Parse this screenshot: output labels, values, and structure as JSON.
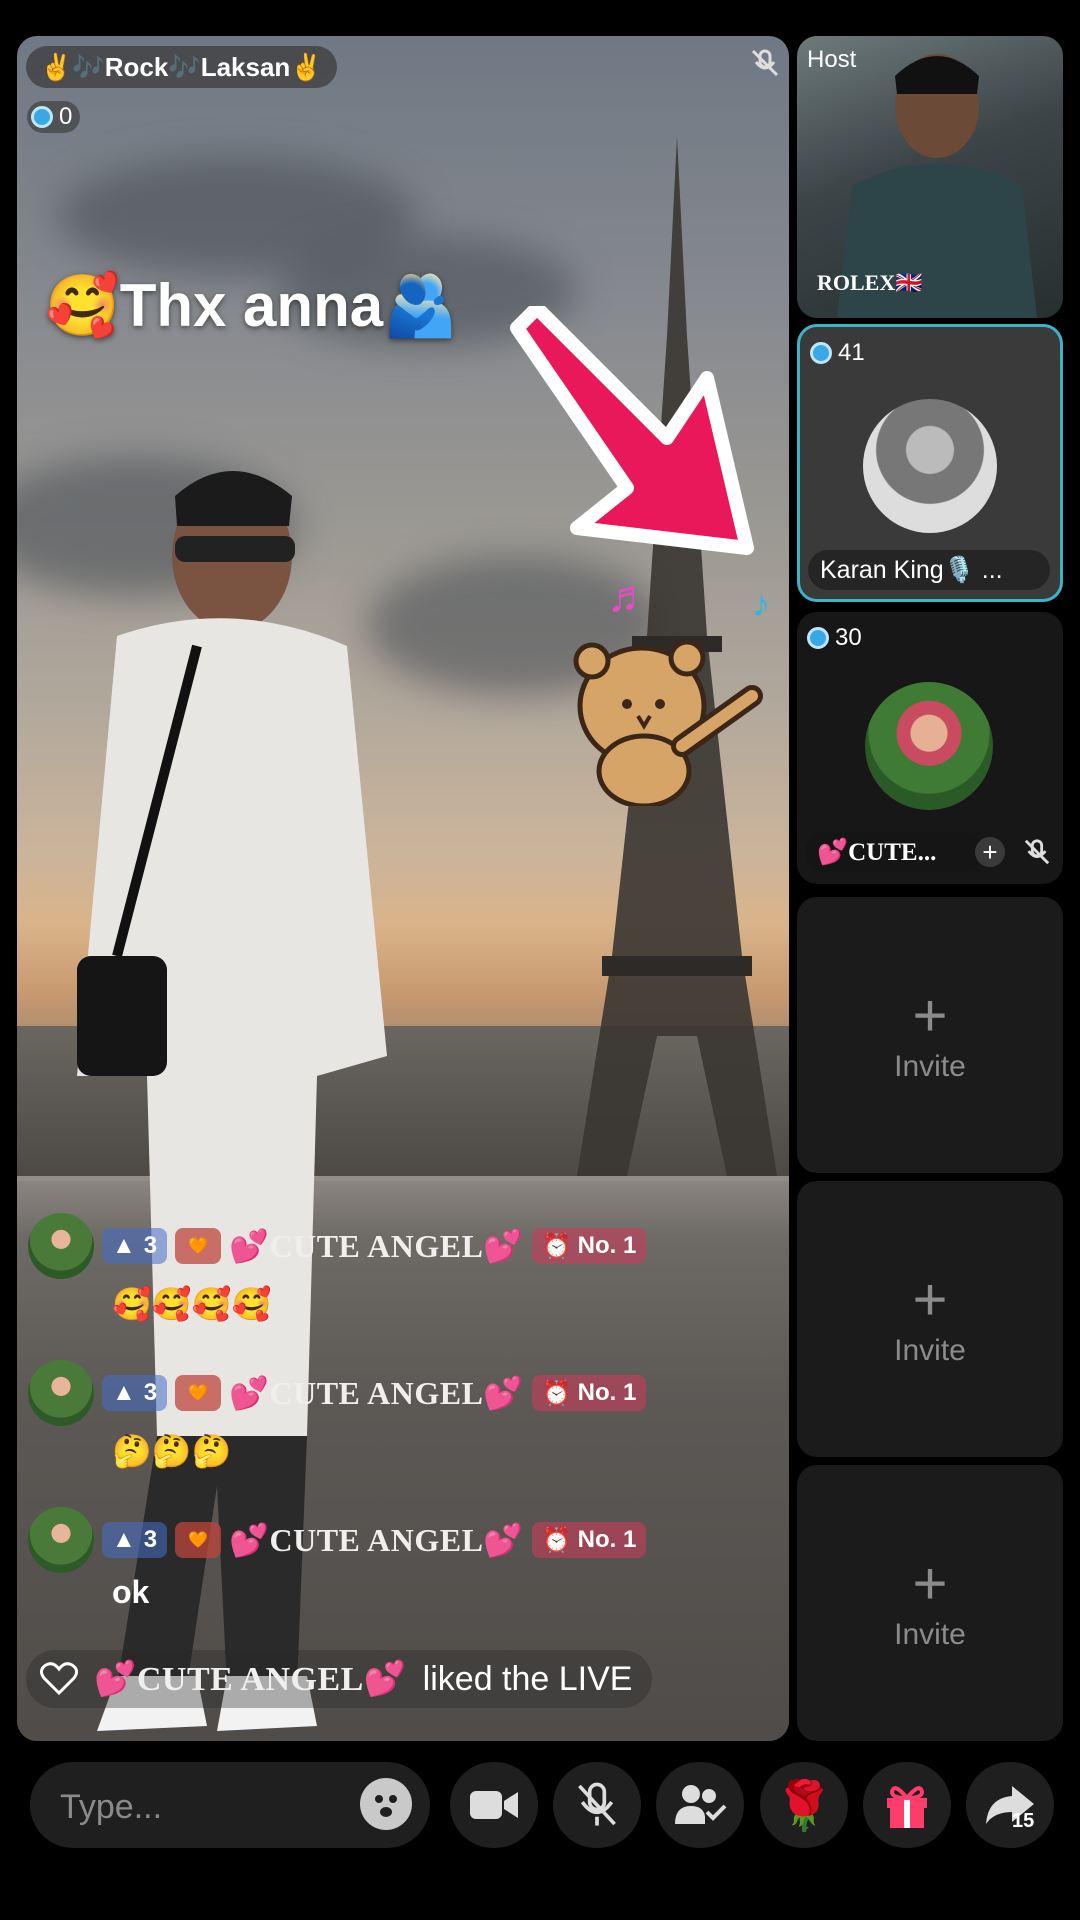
{
  "stream": {
    "title": "✌️🎶Rock🎶Laksan✌️",
    "viewer_count": "0",
    "overlay_text": "🥰Thx anna🫂"
  },
  "chat": [
    {
      "level": "3",
      "user": "💕CUTE ANGEL💕",
      "rank": "No. 1",
      "text": "🥰🥰🥰🥰"
    },
    {
      "level": "3",
      "user": "💕CUTE ANGEL💕",
      "rank": "No. 1",
      "text": "🤔🤔🤔"
    },
    {
      "level": "3",
      "user": "💕CUTE ANGEL💕",
      "rank": "No. 1",
      "text": "ok"
    }
  ],
  "like_notice": {
    "user": "💕CUTE ANGEL💕",
    "text": "liked the LIVE"
  },
  "seats": {
    "host": {
      "label": "Host",
      "name": "ROLEX🇬🇧"
    },
    "guest1": {
      "count": "41",
      "name": "Karan King🎙️ ..."
    },
    "guest2": {
      "count": "30",
      "name": "💕CUTE..."
    },
    "invites": [
      "Invite",
      "Invite",
      "Invite"
    ]
  },
  "bottom_bar": {
    "input_placeholder": "Type...",
    "share_count": "15"
  },
  "icons": [
    "mic-mute-icon",
    "emoji-icon",
    "video-icon",
    "mic-off-icon",
    "guests-icon",
    "rose-icon",
    "gift-icon",
    "share-icon",
    "heart-icon",
    "plus-icon",
    "diamond-icon"
  ],
  "colors": {
    "accent": "#39b5c7",
    "arrow": "#e8185a",
    "gift": "#ff3d6a"
  }
}
